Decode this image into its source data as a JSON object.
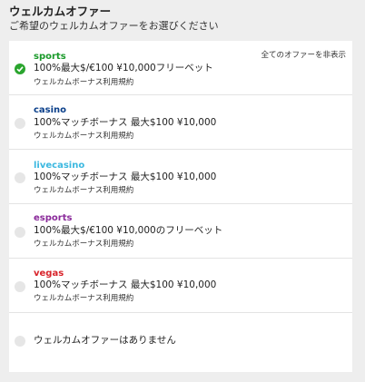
{
  "header": {
    "title": "ウェルカムオファー",
    "subtitle": "ご希望のウェルカムオファーをお選びください"
  },
  "hide_all_label": "全てのオファーを非表示",
  "offers": [
    {
      "brand": "sports",
      "brand_color": "#1a9a2a",
      "description": "100%最大$/€100 ¥10,000フリーベット",
      "terms": "ウェルカムボーナス利用規約",
      "selected": true
    },
    {
      "brand": "casino",
      "brand_color": "#0a3f8a",
      "description": "100%マッチボーナス 最大$100 ¥10,000",
      "terms": "ウェルカムボーナス利用規約",
      "selected": false
    },
    {
      "brand": "livecasino",
      "brand_color": "#3bb8e0",
      "description": "100%マッチボーナス 最大$100 ¥10,000",
      "terms": "ウェルカムボーナス利用規約",
      "selected": false
    },
    {
      "brand": "esports",
      "brand_color": "#8a2a9a",
      "description": "100%最大$/€100 ¥10,000のフリーベット",
      "terms": "ウェルカムボーナス利用規約",
      "selected": false
    },
    {
      "brand": "vegas",
      "brand_color": "#d8232a",
      "description": "100%マッチボーナス 最大$100 ¥10,000",
      "terms": "ウェルカムボーナス利用規約",
      "selected": false
    }
  ],
  "no_offer_label": "ウェルカムオファーはありません"
}
